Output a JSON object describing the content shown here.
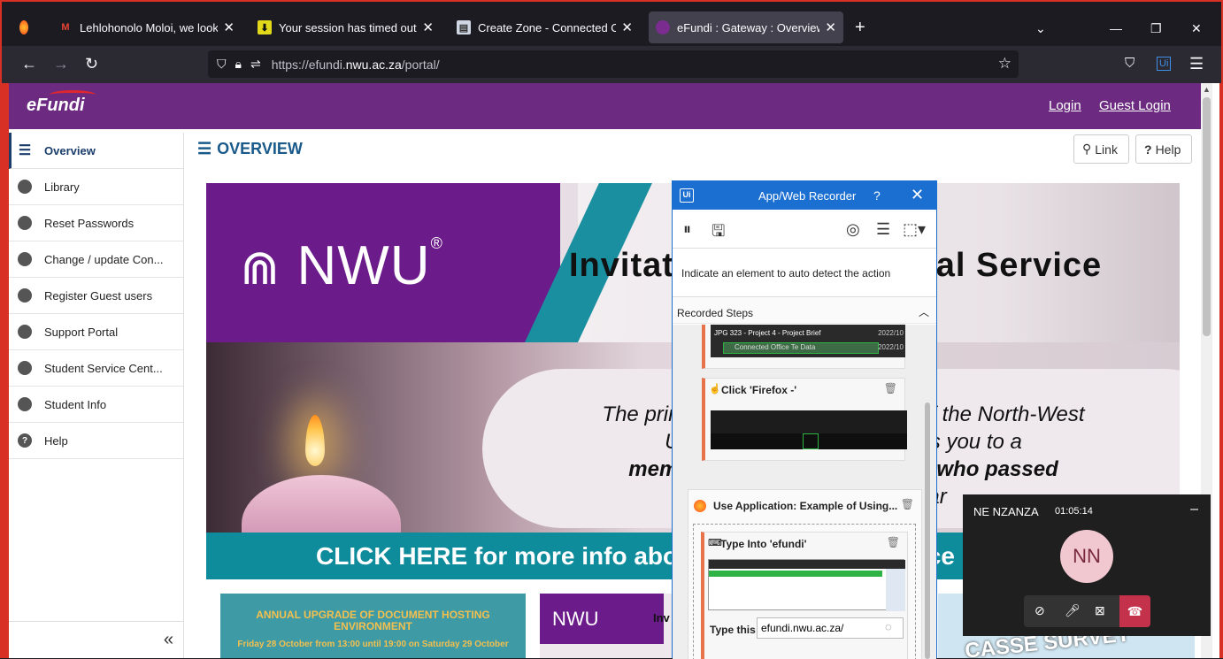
{
  "browser": {
    "tabs": [
      {
        "title": "Lehlohonolo Moloi, we look for",
        "icon": "gmail-icon"
      },
      {
        "title": "Your session has timed out.",
        "icon": "download-icon"
      },
      {
        "title": "Create Zone - Connected Office",
        "icon": "document-icon"
      },
      {
        "title": "eFundi : Gateway : Overview",
        "icon": "efundi-icon"
      }
    ],
    "url_prefix": "https://efundi.",
    "url_domain": "nwu.ac.za",
    "url_path": "/portal/"
  },
  "header": {
    "logo": "eFundi",
    "login": "Login",
    "guest_login": "Guest Login"
  },
  "sidebar": {
    "items": [
      {
        "label": "Overview"
      },
      {
        "label": "Library"
      },
      {
        "label": "Reset Passwords"
      },
      {
        "label": "Change / update Con..."
      },
      {
        "label": "Register Guest users"
      },
      {
        "label": "Support Portal"
      },
      {
        "label": "Student Service Cent..."
      },
      {
        "label": "Student Info"
      },
      {
        "label": "Help"
      }
    ],
    "collapse": "«"
  },
  "content": {
    "title": "OVERVIEW",
    "link_btn": "Link",
    "help_btn": "Help"
  },
  "banner": {
    "logo": "NWU",
    "reg": "®",
    "title": "Invitation to a Memorial Service",
    "text_line1": "The principal and vice-chancellor of the North-West",
    "text_line2": "University, Dr cordially invites you to a",
    "text_line3": "memorial service for students who passed",
    "text_line4": "on this academic year",
    "cta": "CLICK HERE for more info about the memorial service"
  },
  "cards": {
    "c1_title": "ANNUAL UPGRADE OF DOCUMENT HOSTING ENVIRONMENT",
    "c1_sub": "Friday 28 October from 13:00 until 19:00 on Saturday 29 October",
    "c2_logo": "NWU",
    "c2_text": "Inv",
    "c3_text": "CASSE SURVEY"
  },
  "recorder": {
    "title": "App/Web Recorder",
    "help": "?",
    "hint": "Indicate an element to auto detect the action",
    "steps_header": "Recorded Steps",
    "step1_thumb_a": "JPG 323 - Project 4 - Project Brief",
    "step1_thumb_b": "Connected Office Te Data",
    "step1_date_a": "2022/10",
    "step1_date_b": "2022/10",
    "step2_label": "Click 'Firefox -'",
    "group_label": "Use Application: Example of Using...",
    "step3_label": "Type Into 'efundi'",
    "type_this_label": "Type this",
    "type_this_value": "efundi.nwu.ac.za/"
  },
  "call": {
    "name": "NE NZANZA",
    "time": "01:05:14",
    "initials": "NN"
  }
}
